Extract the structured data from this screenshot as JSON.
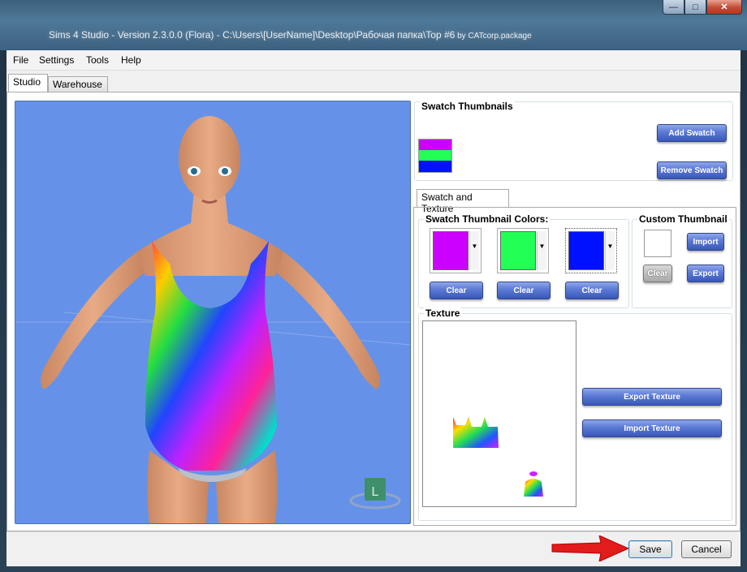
{
  "window": {
    "title_main": "Sims 4 Studio - Version 2.3.0.0  (Flora)   - C:\\Users\\[UserName]\\Desktop\\Рабочая папка\\Top #6",
    "title_small": " by CATcorp.package",
    "controls": {
      "minimize": "—",
      "maximize": "□",
      "close": "✕"
    }
  },
  "menu": {
    "file": "File",
    "settings": "Settings",
    "tools": "Tools",
    "help": "Help"
  },
  "tabs": {
    "studio": "Studio",
    "warehouse": "Warehouse"
  },
  "viewport": {
    "bg_color": "#6592e8",
    "badge_letter": "L"
  },
  "swatch_thumbnails": {
    "title": "Swatch Thumbnails",
    "add": "Add Swatch",
    "remove": "Remove Swatch",
    "colors": [
      "#cc00ff",
      "#22ff55",
      "#0011ff"
    ]
  },
  "swatch_texture_tab": "Swatch and Texture",
  "thumbnail_colors": {
    "title": "Swatch Thumbnail Colors:",
    "colors": [
      "#cc00ff",
      "#22ff55",
      "#0011ff"
    ],
    "clear": "Clear"
  },
  "custom_thumbnail": {
    "title": "Custom Thumbnail",
    "import": "Import",
    "clear": "Clear",
    "export": "Export"
  },
  "texture": {
    "title": "Texture",
    "export": "Export Texture",
    "import": "Import Texture"
  },
  "footer": {
    "save": "Save",
    "cancel": "Cancel"
  }
}
